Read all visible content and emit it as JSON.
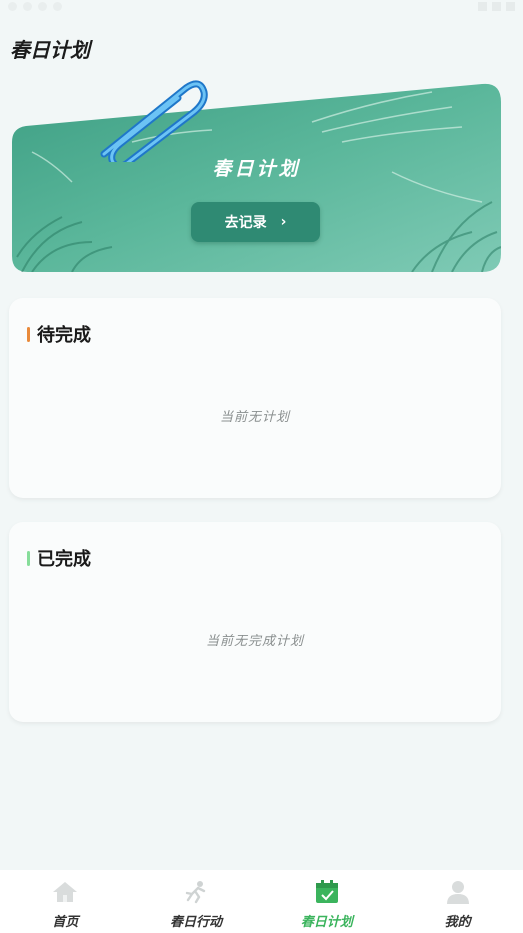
{
  "page": {
    "title": "春日计划"
  },
  "banner": {
    "title": "春日计划",
    "button_label": "去记录",
    "button_icon": "chevron-right-icon"
  },
  "sections": [
    {
      "title": "待完成",
      "accent": "#e98a3b",
      "empty_text": "当前无计划"
    },
    {
      "title": "已完成",
      "accent": "#86dd9a",
      "empty_text": "当前无完成计划"
    }
  ],
  "tabbar": {
    "active_color": "#3bb45d",
    "items": [
      {
        "label": "首页",
        "icon": "home-icon",
        "active": false
      },
      {
        "label": "春日行动",
        "icon": "running-icon",
        "active": false
      },
      {
        "label": "春日计划",
        "icon": "calendar-check-icon",
        "active": true
      },
      {
        "label": "我的",
        "icon": "user-icon",
        "active": false
      }
    ]
  }
}
